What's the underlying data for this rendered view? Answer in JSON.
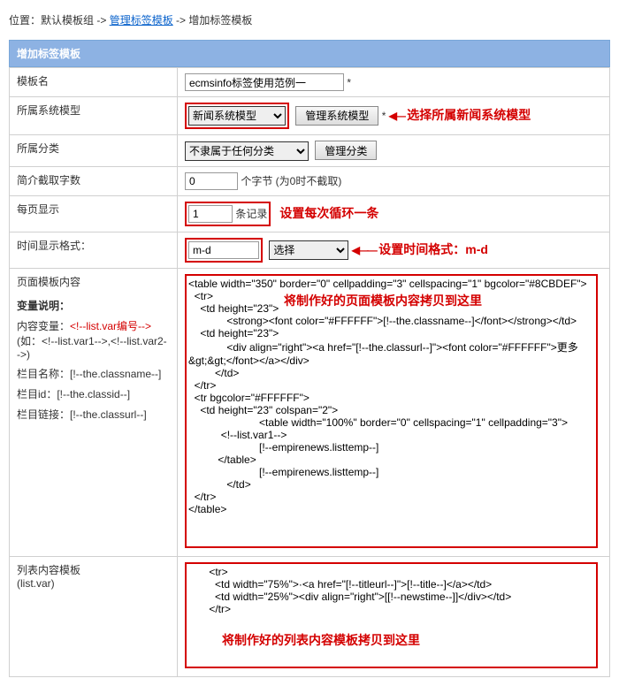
{
  "breadcrumb": {
    "prefix": "位置：默认模板组 -> ",
    "link1": "管理标签模板",
    "sep": " -> ",
    "current": "增加标签模板"
  },
  "title_bar": "增加标签模板",
  "rows": {
    "name": {
      "label": "模板名",
      "value": "ecmsinfo标签使用范例一",
      "star": "*"
    },
    "model": {
      "label": "所属系统模型",
      "select_value": "新闻系统模型",
      "btn": "管理系统模型",
      "star": "*",
      "annot": "选择所属新闻系统模型"
    },
    "category": {
      "label": "所属分类",
      "select_value": "不隶属于任何分类",
      "btn": "管理分类"
    },
    "brief": {
      "label": "简介截取字数",
      "value": "0",
      "suffix": "个字节 (为0时不截取)"
    },
    "per": {
      "label": "每页显示",
      "value": "1",
      "suffix": "条记录",
      "annot": "设置每次循环一条"
    },
    "time": {
      "label": "时间显示格式：",
      "value": "m-d",
      "select": "选择",
      "annot": "设置时间格式：m-d"
    },
    "page": {
      "label": "页面模板内容",
      "sub1": "变量说明：",
      "sub2_a": "内容变量：",
      "sub2_b": "<!--list.var编号-->",
      "sub3": "(如：<!--list.var1-->,<!--list.var2-->)",
      "sub4": "栏目名称：[!--the.classname--]",
      "sub5": "栏目id：[!--the.classid--]",
      "sub6": "栏目链接：[!--the.classurl--]",
      "content": "<table width=\"350\" border=\"0\" cellpadding=\"3\" cellspacing=\"1\" bgcolor=\"#8CBDEF\">\n  <tr>\n    <td height=\"23\">\n             <strong><font color=\"#FFFFFF\">[!--the.classname--]</font></strong></td>\n    <td height=\"23\">\n             <div align=\"right\"><a href=\"[!--the.classurl--]\"><font color=\"#FFFFFF\">更多&gt;&gt;</font></a></div>\n         </td>\n  </tr>\n  <tr bgcolor=\"#FFFFFF\">\n    <td height=\"23\" colspan=\"2\">\n                        <table width=\"100%\" border=\"0\" cellspacing=\"1\" cellpadding=\"3\">\n           <!--list.var1-->\n                        [!--empirenews.listtemp--]\n          </table>\n                        [!--empirenews.listtemp--]\n             </td>\n  </tr>\n</table>",
      "annot": "将制作好的页面模板内容拷贝到这里"
    },
    "list": {
      "label": "列表内容模板",
      "sublabel": "(list.var)",
      "content": "       <tr>\n         <td width=\"75%\">·<a href=\"[!--titleurl--]\">[!--title--]</a></td>\n         <td width=\"25%\"><div align=\"right\">[[!--newstime--]]</div></td>\n       </tr>",
      "annot": "将制作好的列表内容模板拷贝到这里"
    }
  }
}
